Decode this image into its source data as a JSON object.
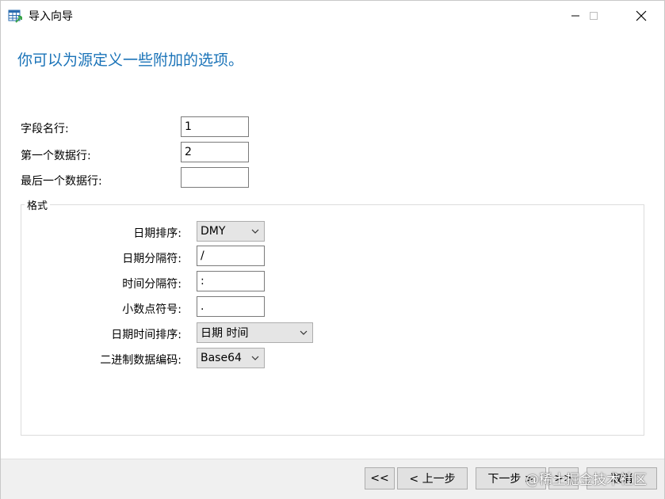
{
  "window": {
    "title": "导入向导",
    "controls": [
      "minimize",
      "maximize",
      "close"
    ]
  },
  "heading": "你可以为源定义一些附加的选项。",
  "fields": {
    "field_name_row": {
      "label": "字段名行:",
      "value": "1"
    },
    "first_data_row": {
      "label": "第一个数据行:",
      "value": "2"
    },
    "last_data_row": {
      "label": "最后一个数据行:",
      "value": ""
    }
  },
  "format_group": {
    "title": "格式",
    "date_order": {
      "label": "日期排序:",
      "value": "DMY"
    },
    "date_separator": {
      "label": "日期分隔符:",
      "value": "/"
    },
    "time_separator": {
      "label": "时间分隔符:",
      "value": ":"
    },
    "decimal_symbol": {
      "label": "小数点符号:",
      "value": "."
    },
    "datetime_order": {
      "label": "日期时间排序:",
      "value": "日期 时间"
    },
    "binary_encoding": {
      "label": "二进制数据编码:",
      "value": "Base64"
    }
  },
  "footer": {
    "first_label": "<<",
    "prev_label": "< 上一步",
    "next_label": "下一步 >",
    "last_label": ">>",
    "cancel_label": "取消"
  },
  "watermark": "@稀土掘金技术社区",
  "colors": {
    "heading": "#1a73b8",
    "footer_bg": "#f0f0f0",
    "button_bg": "#e1e1e1"
  }
}
